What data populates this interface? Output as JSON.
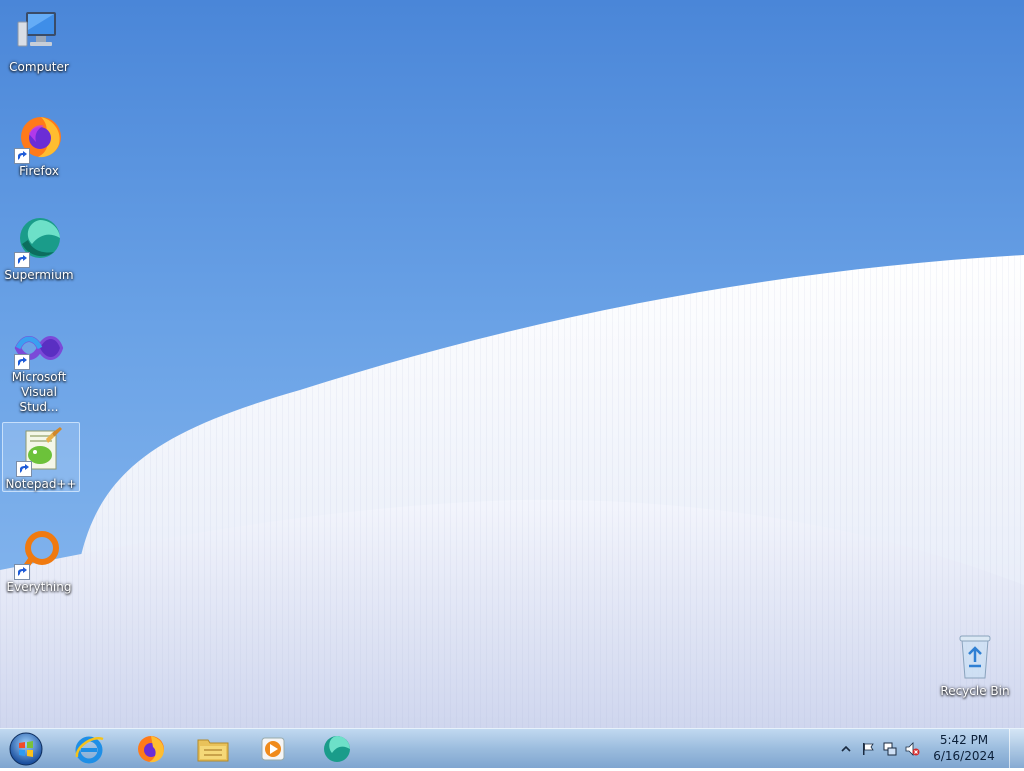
{
  "desktop_icons": [
    {
      "label": "Computer",
      "icon": "computer-icon"
    },
    {
      "label": "Firefox",
      "icon": "firefox-icon"
    },
    {
      "label": "Supermium",
      "icon": "supermium-icon"
    },
    {
      "label": "Microsoft Visual Stud...",
      "icon": "visual-studio-icon"
    },
    {
      "label": "Notepad++",
      "icon": "notepad-plus-plus-icon"
    },
    {
      "label": "Everything",
      "icon": "everything-icon"
    },
    {
      "label": "Recycle Bin",
      "icon": "recycle-bin-icon"
    }
  ],
  "taskbar": {
    "start": "start-orb-icon",
    "pinned": [
      "internet-explorer-icon",
      "firefox-icon",
      "file-explorer-icon",
      "media-player-icon",
      "supermium-icon"
    ]
  },
  "tray": {
    "time": "5:42 PM",
    "date": "6/16/2024"
  }
}
